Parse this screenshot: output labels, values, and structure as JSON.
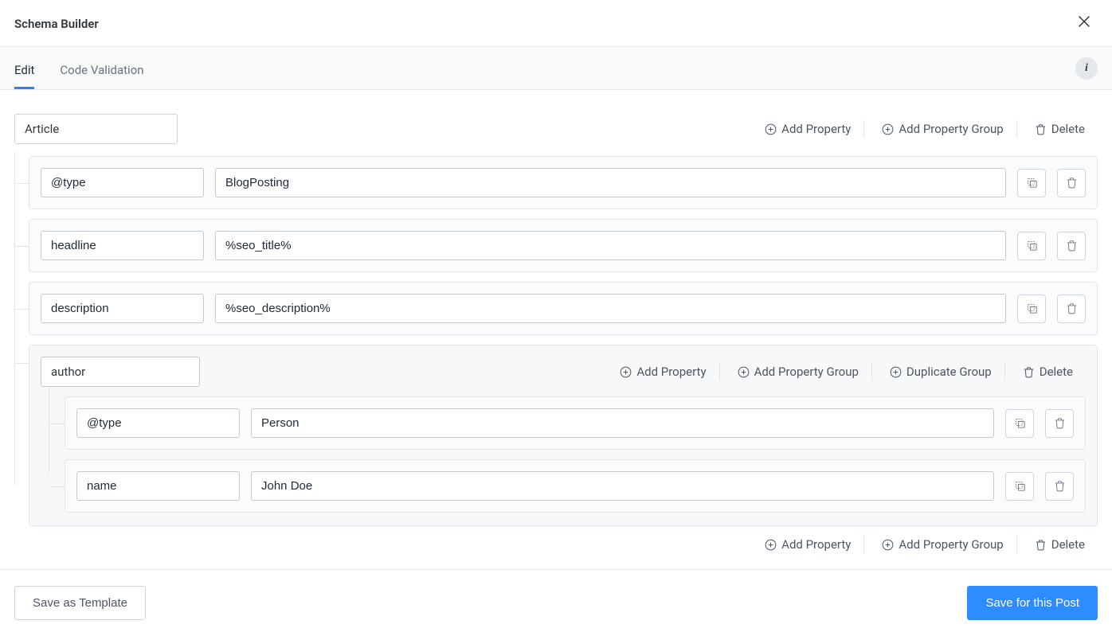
{
  "header": {
    "title": "Schema Builder"
  },
  "tabs": {
    "edit": "Edit",
    "validation": "Code Validation"
  },
  "actions": {
    "addProperty": "Add Property",
    "addPropertyGroup": "Add Property Group",
    "duplicateGroup": "Duplicate Group",
    "delete": "Delete"
  },
  "schema": {
    "root": "Article",
    "props": [
      {
        "key": "@type",
        "value": "BlogPosting"
      },
      {
        "key": "headline",
        "value": "%seo_title%"
      },
      {
        "key": "description",
        "value": "%seo_description%"
      }
    ],
    "group": {
      "label": "author",
      "props": [
        {
          "key": "@type",
          "value": "Person"
        },
        {
          "key": "name",
          "value": "John Doe"
        }
      ]
    }
  },
  "footer": {
    "saveTemplate": "Save as Template",
    "savePost": "Save for this Post"
  }
}
